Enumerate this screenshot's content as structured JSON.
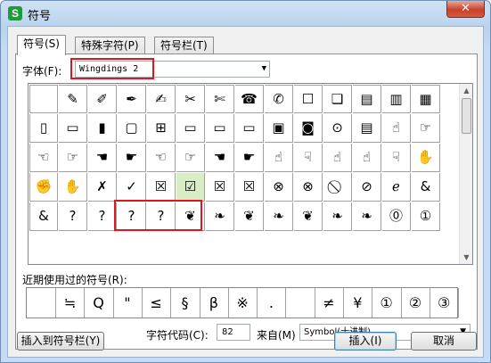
{
  "window": {
    "title": "符号",
    "app_icon": "S",
    "close_glyph": "✕"
  },
  "tabs": [
    {
      "label": "符号(S)",
      "active": true
    },
    {
      "label": "特殊字符(P)",
      "active": false
    },
    {
      "label": "符号栏(T)",
      "active": false
    }
  ],
  "font": {
    "label": "字体(F):",
    "value": "Wingdings 2"
  },
  "symbol_grid": [
    [
      "",
      "✎",
      "✐",
      "✒",
      "✍",
      "✂",
      "✄",
      "☎",
      "✆",
      "☐",
      "❏",
      "▤",
      "▥",
      "▦"
    ],
    [
      "▯",
      "▭",
      "▮",
      "▢",
      "⊞",
      "▭",
      "▭",
      "▭",
      "▣",
      "◙",
      "⊙",
      "▤",
      "☝",
      "☞"
    ],
    [
      "☜",
      "☞",
      "☚",
      "☛",
      "☜",
      "☞",
      "☚",
      "☛",
      "☝",
      "☟",
      "☝",
      "☝",
      "☟",
      "✋"
    ],
    [
      "✊",
      "✋",
      "✗",
      "✓",
      "☒",
      "☑",
      "☒",
      "☒",
      "⊗",
      "⊗",
      "⃠",
      "⊘",
      "ℯ",
      "&"
    ],
    [
      "&",
      "?",
      "?",
      "?",
      "?",
      "❦",
      "❧",
      "❦",
      "❧",
      "❦",
      "❧",
      "❧",
      "⓪",
      "①"
    ]
  ],
  "recent": {
    "label": "近期使用过的符号(R):",
    "symbols": [
      "",
      "≒",
      "Q",
      "\"",
      "≤",
      "§",
      "β",
      "※",
      ".",
      "",
      "≠",
      "¥",
      "①",
      "②",
      "③"
    ]
  },
  "char_code": {
    "label": "字符代码(C):",
    "value": "82"
  },
  "from": {
    "label": "来自(M)",
    "value": "Symbol(十进制)"
  },
  "buttons": {
    "insert_to_bar": "插入到符号栏(Y)",
    "insert": "插入(I)",
    "cancel": "取消"
  },
  "scroll": {
    "up": "▲",
    "down": "▼"
  }
}
